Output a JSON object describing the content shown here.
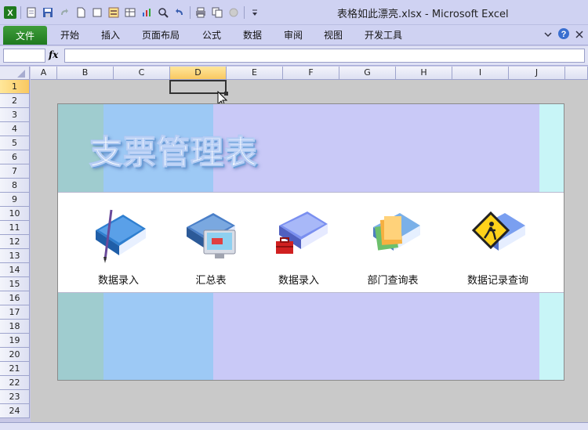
{
  "window": {
    "title": "表格如此漂亮.xlsx  -  Microsoft Excel"
  },
  "ribbon": {
    "file_tab": "文件",
    "tabs": [
      {
        "id": "home",
        "label": "开始"
      },
      {
        "id": "insert",
        "label": "插入"
      },
      {
        "id": "page-layout",
        "label": "页面布局"
      },
      {
        "id": "formulas",
        "label": "公式"
      },
      {
        "id": "data",
        "label": "数据"
      },
      {
        "id": "review",
        "label": "审阅"
      },
      {
        "id": "view",
        "label": "视图"
      },
      {
        "id": "developer",
        "label": "开发工具"
      }
    ]
  },
  "formula_bar": {
    "fx_label": "fx",
    "name_box": "",
    "formula": ""
  },
  "grid": {
    "columns": [
      "A",
      "B",
      "C",
      "D",
      "E",
      "F",
      "G",
      "H",
      "I",
      "J"
    ],
    "rows": [
      "1",
      "2",
      "3",
      "4",
      "5",
      "6",
      "7",
      "8",
      "9",
      "10",
      "11",
      "12",
      "13",
      "14",
      "15",
      "16",
      "17",
      "18",
      "19",
      "20",
      "21",
      "22",
      "23",
      "24"
    ],
    "active_column": "D",
    "active_row": "1"
  },
  "dashboard": {
    "banner_title": "支票管理表",
    "menu_items": [
      {
        "id": "data-entry-1",
        "label": "数据录入",
        "icon": "blue-book-pen-icon"
      },
      {
        "id": "summary",
        "label": "汇总表",
        "icon": "book-monitor-icon"
      },
      {
        "id": "data-entry-2",
        "label": "数据录入",
        "icon": "book-toolbox-icon"
      },
      {
        "id": "dept-query",
        "label": "部门查询表",
        "icon": "book-folders-icon"
      },
      {
        "id": "record-query",
        "label": "数据记录查询",
        "icon": "book-warning-sign-icon"
      }
    ],
    "colors": {
      "teal": "#9fcccf",
      "sky": "#9dc9f5",
      "lavender": "#c9c9f7",
      "aqua": "#c8f5f7"
    }
  }
}
